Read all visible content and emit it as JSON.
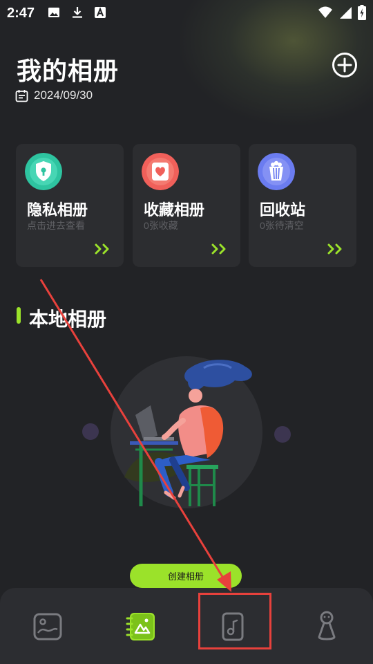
{
  "status_bar": {
    "time": "2:47",
    "icons_left": [
      "image-icon",
      "download-icon",
      "font-icon"
    ],
    "icons_right": [
      "wifi-icon",
      "signal-icon",
      "battery-charging-icon"
    ]
  },
  "header": {
    "title": "我的相册",
    "date": "2024/09/30",
    "add_icon": "plus-circle-icon"
  },
  "cards": [
    {
      "title": "隐私相册",
      "subtitle": "点击进去查看",
      "icon": "shield-lock-icon",
      "color": "#2ec4a0"
    },
    {
      "title": "收藏相册",
      "subtitle": "0张收藏",
      "icon": "heart-icon",
      "color": "#f0605a"
    },
    {
      "title": "回收站",
      "subtitle": "0张待清空",
      "icon": "popcorn-bin-icon",
      "color": "#6b7cf0"
    }
  ],
  "section": {
    "title": "本地相册"
  },
  "create_button": {
    "label": "创建相册"
  },
  "bottom_nav": [
    {
      "name": "photos",
      "icon": "photo-frame-icon",
      "active": false
    },
    {
      "name": "albums",
      "icon": "album-notebook-icon",
      "active": true
    },
    {
      "name": "music",
      "icon": "music-note-icon",
      "active": false
    },
    {
      "name": "profile",
      "icon": "person-icon",
      "active": false
    }
  ],
  "colors": {
    "accent": "#9be22a",
    "background": "#222326",
    "card": "#2c2d30",
    "annotation": "#e8413c"
  }
}
